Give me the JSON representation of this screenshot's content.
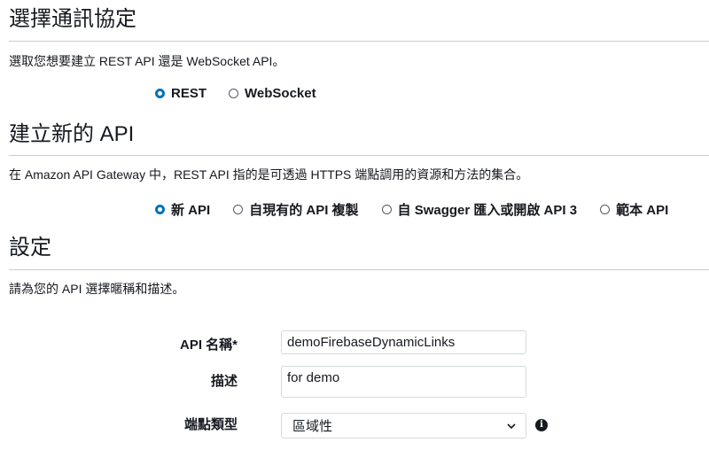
{
  "protocol": {
    "title": "選擇通訊協定",
    "description": "選取您想要建立 REST API 還是 WebSocket API。",
    "options": [
      {
        "label": "REST",
        "checked": true
      },
      {
        "label": "WebSocket",
        "checked": false
      }
    ]
  },
  "create": {
    "title": "建立新的 API",
    "description": "在 Amazon API Gateway 中，REST API 指的是可透過 HTTPS 端點調用的資源和方法的集合。",
    "options": [
      {
        "label": "新 API",
        "checked": true
      },
      {
        "label": "自現有的 API 複製",
        "checked": false
      },
      {
        "label": "自 Swagger 匯入或開啟 API 3",
        "checked": false
      },
      {
        "label": "範本 API",
        "checked": false
      }
    ]
  },
  "settings": {
    "title": "設定",
    "description": "請為您的 API 選擇暱稱和描述。",
    "api_name_label": "API 名稱*",
    "api_name_value": "demoFirebaseDynamicLinks",
    "description_label": "描述",
    "description_value": "for demo",
    "endpoint_label": "端點類型",
    "endpoint_value": "區域性",
    "info_icon": "info-icon",
    "accent_color": "#0073bb"
  }
}
